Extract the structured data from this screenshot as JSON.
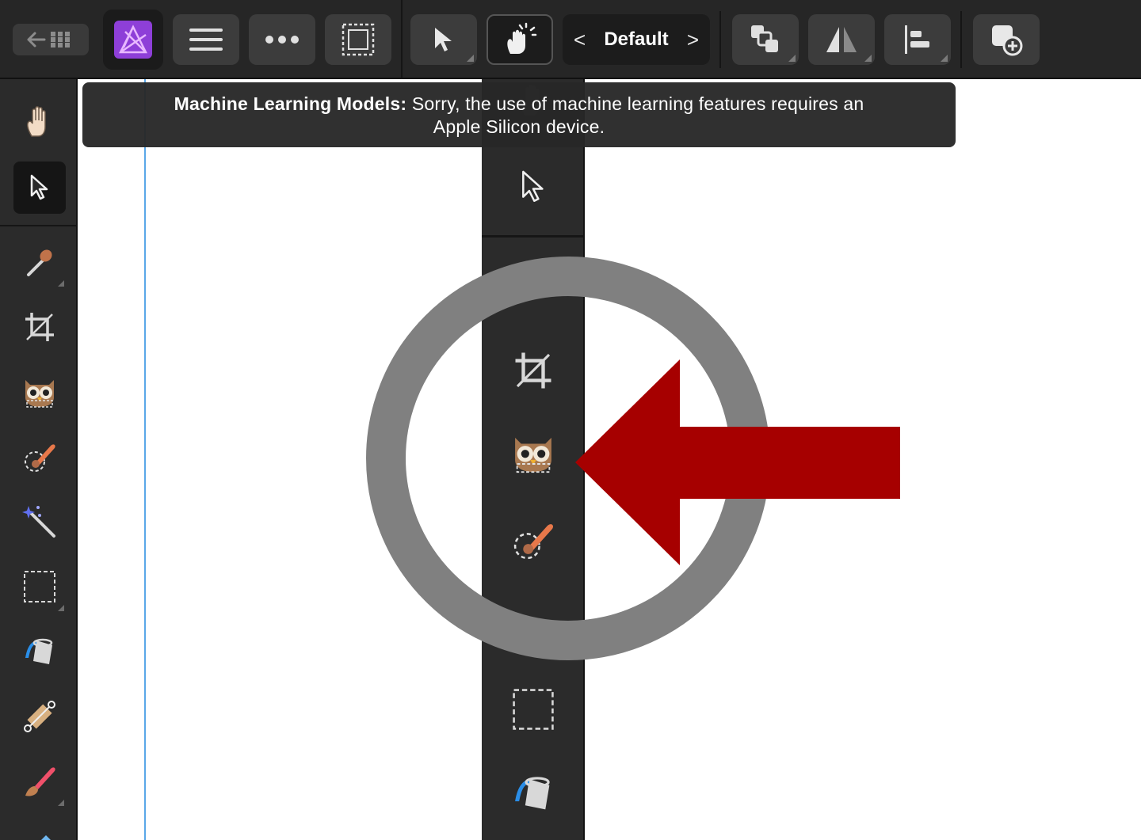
{
  "banner": {
    "title": "Machine Learning Models:",
    "message_line1": "Sorry, the use of machine learning features requires an",
    "message_line2": "Apple Silicon device."
  },
  "toolbar": {
    "preset_label": "Default",
    "preset_prev": "<",
    "preset_next": ">"
  },
  "icons": {
    "top": [
      "back-to-gallery-icon",
      "affinity-photo-persona-icon",
      "menu-icon",
      "more-icon",
      "selection-marquee-icon",
      "move-tool-icon",
      "touch-gesture-icon",
      "arrange-icon",
      "flip-icon",
      "align-icon",
      "add-layer-icon"
    ],
    "left": [
      "hand-icon",
      "move-tool-icon",
      "color-picker-icon",
      "crop-icon",
      "owl-subject-selection-icon",
      "selection-brush-icon",
      "magic-wand-icon",
      "rectangle-marquee-icon",
      "flood-fill-icon",
      "gradient-icon",
      "paint-brush-icon",
      "eraser-icon"
    ]
  },
  "colors": {
    "annotation_arrow": "#a60000",
    "annotation_circle": "#808080",
    "persona_accent": "#a24de0"
  }
}
